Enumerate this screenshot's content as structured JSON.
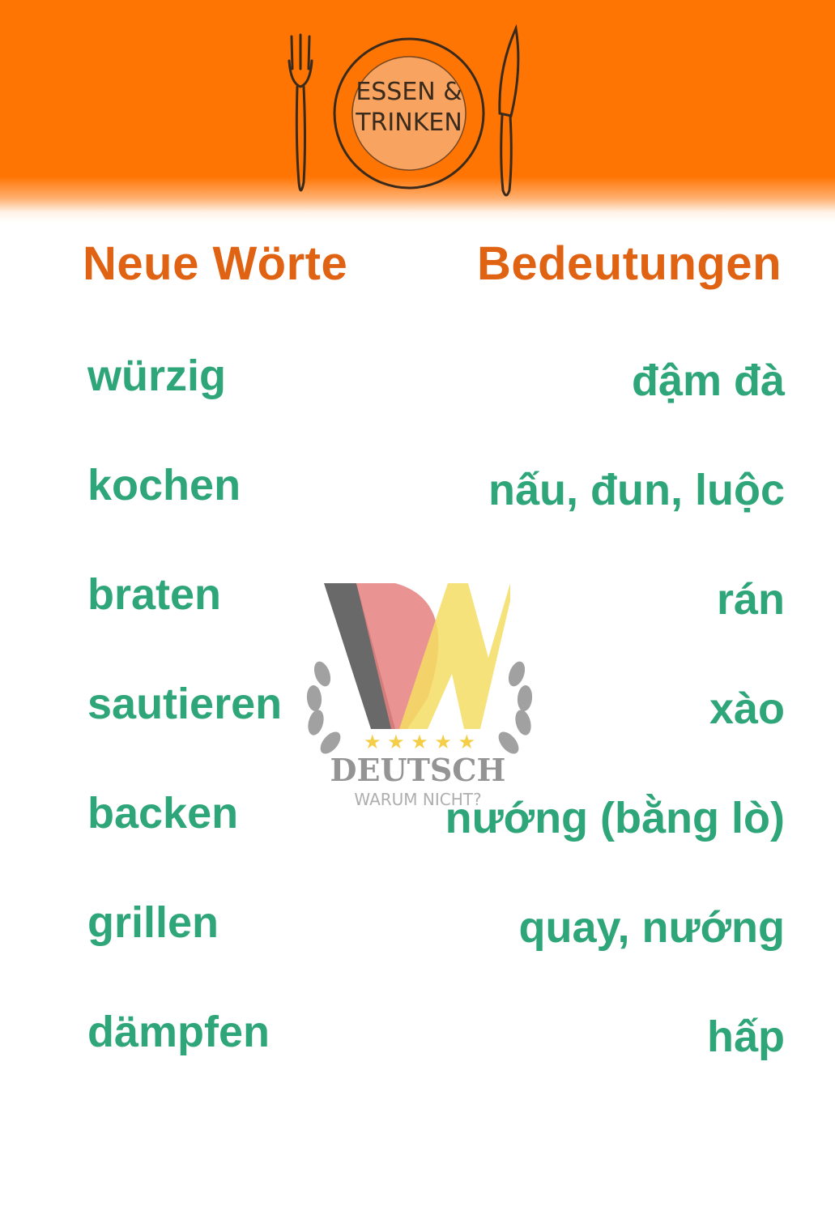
{
  "header": {
    "logo_line1": "ESSEN &",
    "logo_line2": "TRINKEN",
    "accent": "#ff7504"
  },
  "columns": {
    "left_title": "Neue Wörte",
    "right_title": "Bedeutungen",
    "title_color": "#e06314",
    "word_color": "#2fa67a"
  },
  "words": [
    {
      "de": "würzig",
      "vi": "đậm đà"
    },
    {
      "de": "kochen",
      "vi": "nấu, đun, luộc"
    },
    {
      "de": "braten",
      "vi": "rán"
    },
    {
      "de": "sautieren",
      "vi": "xào"
    },
    {
      "de": "backen",
      "vi": "nướng (bằng lò)"
    },
    {
      "de": "grillen",
      "vi": "quay, nướng"
    },
    {
      "de": "dämpfen",
      "vi": "hấp"
    }
  ],
  "watermark": {
    "line1": "DEUTSCH",
    "line2": "WARUM NICHT?",
    "icon": "dw-laurel-logo"
  }
}
